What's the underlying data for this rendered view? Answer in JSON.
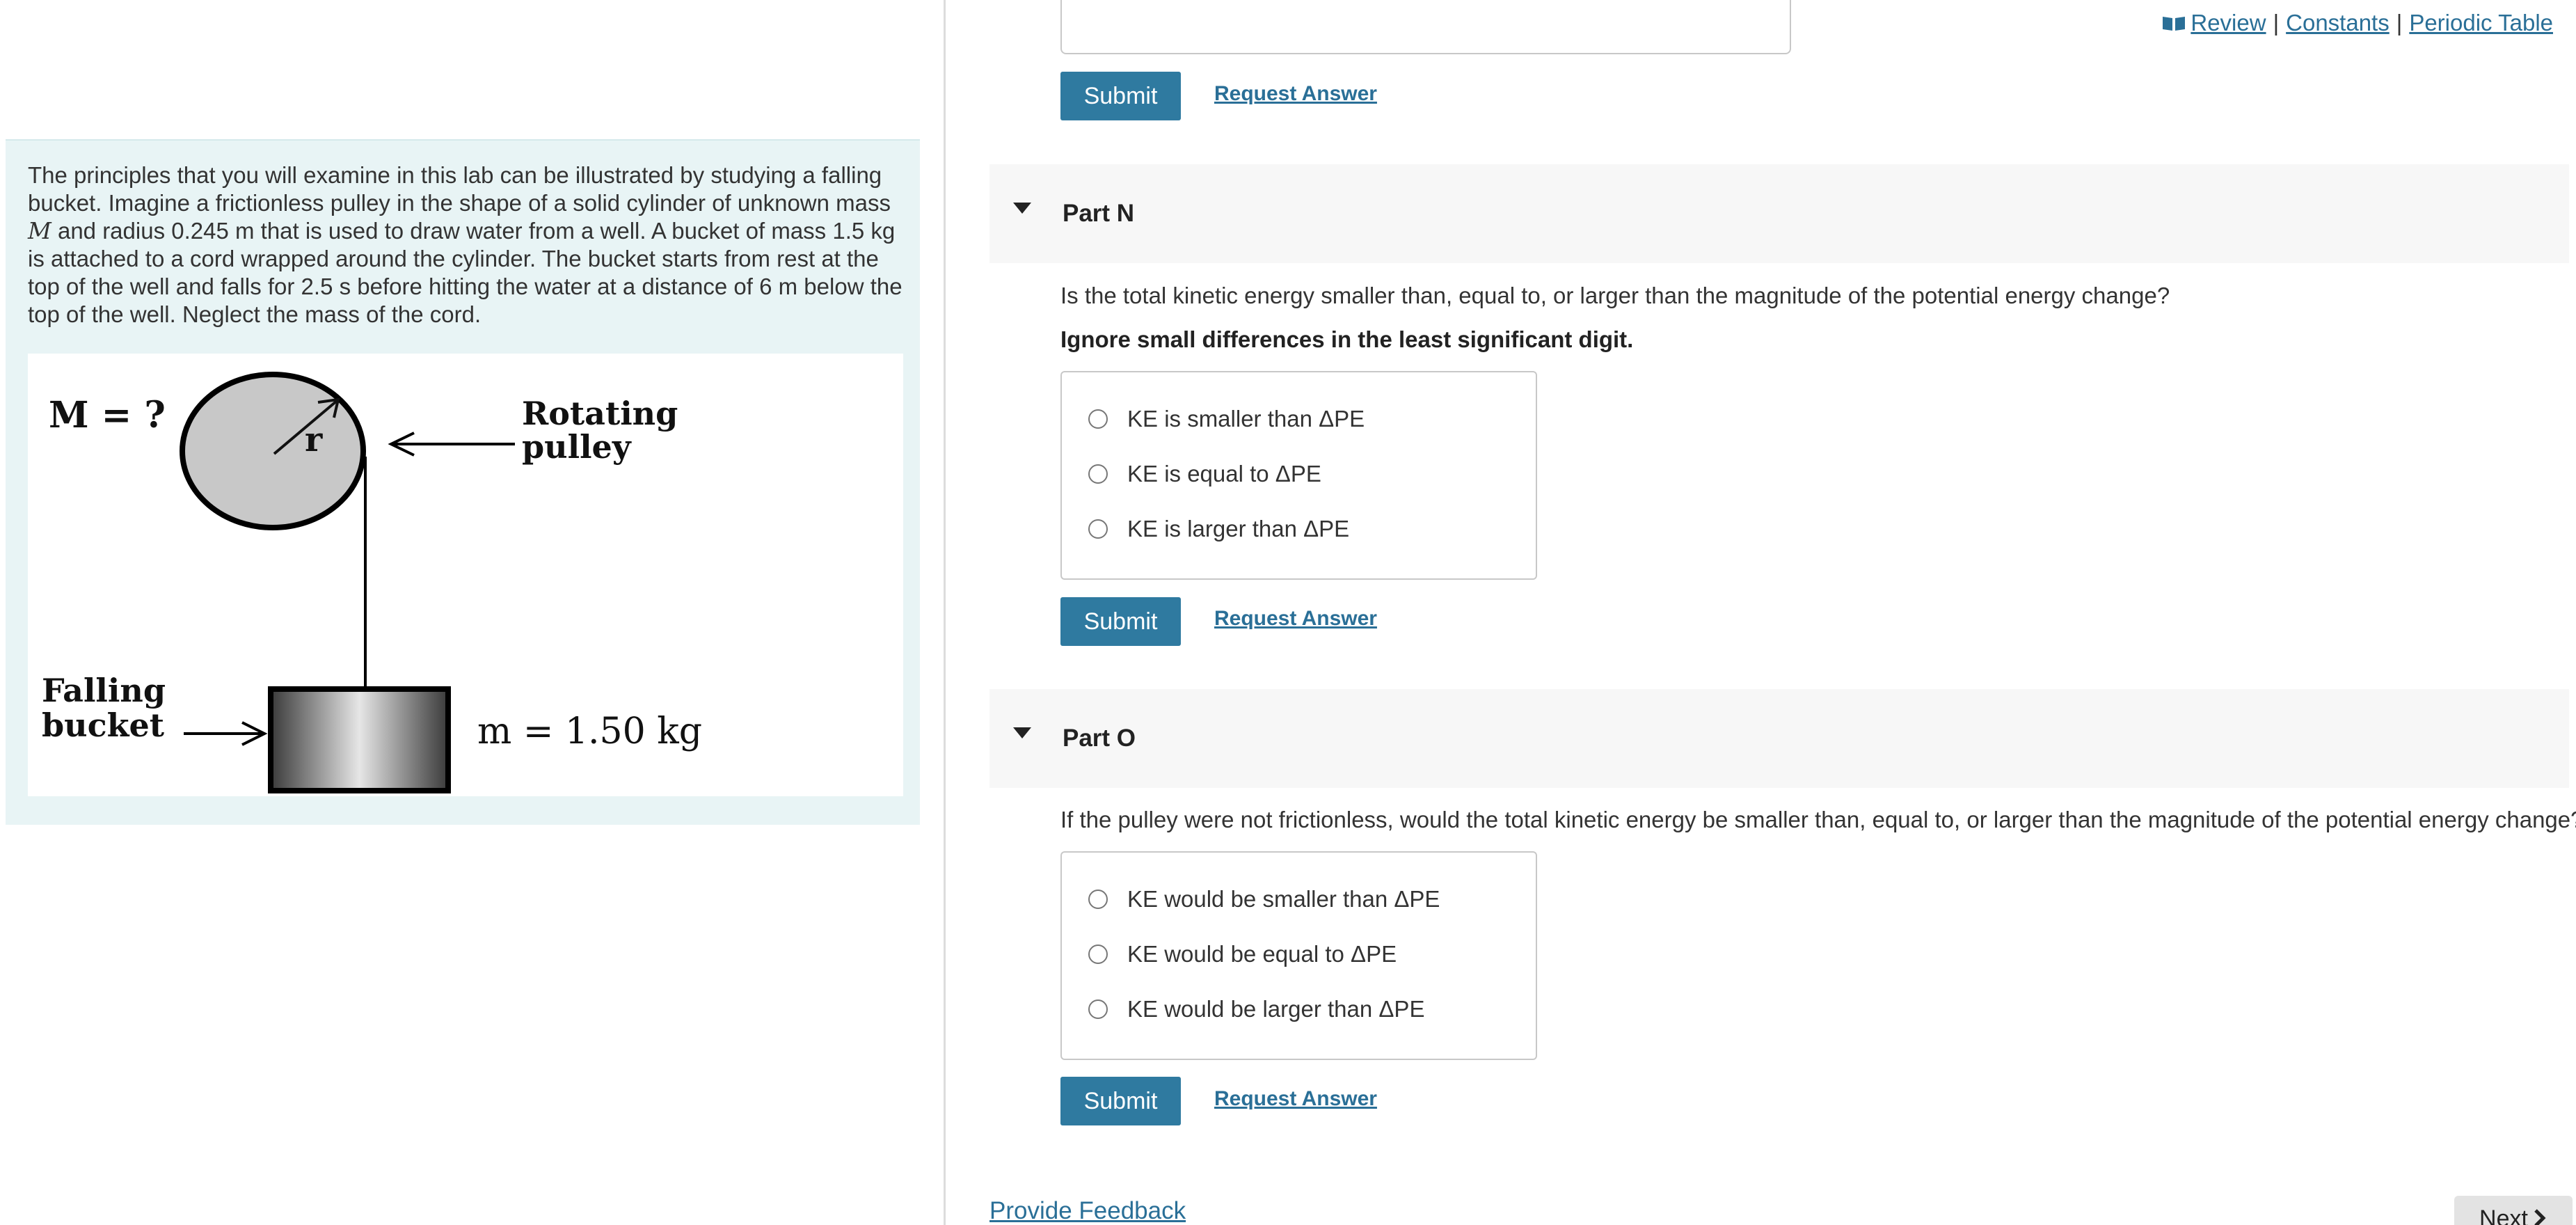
{
  "links": {
    "review": "Review",
    "constants": "Constants",
    "periodic_table": "Periodic Table",
    "sep": "|"
  },
  "intro": {
    "text_1": "The principles that you will examine in this lab can be illustrated by studying a falling bucket. Imagine a frictionless pulley in the shape of a solid cylinder of unknown mass",
    "mass_symbol": "M",
    "text_2": "and radius 0.245 m that is used to draw water from a well. A bucket of mass 1.5 kg is attached to a cord wrapped around the cylinder. The bucket starts from rest at the top of the well and falls for 2.5 s before hitting the water at a distance of 6 m below the top of the well. Neglect the mass of the cord."
  },
  "figure": {
    "mass_label": "M = ?",
    "radius_label": "r",
    "pulley_label_1": "Rotating",
    "pulley_label_2": "pulley",
    "bucket_label_1": "Falling",
    "bucket_label_2": "bucket",
    "bucket_mass": "m = 1.50 kg"
  },
  "top_section": {
    "submit": "Submit",
    "request": "Request Answer"
  },
  "part_n": {
    "title": "Part N",
    "question": "Is the total kinetic energy smaller than, equal to, or larger than the magnitude of the potential energy change?",
    "note": "Ignore small differences in the least significant digit.",
    "choices": [
      "KE is smaller than ΔPE",
      "KE is equal to ΔPE",
      "KE is larger than ΔPE"
    ],
    "submit": "Submit",
    "request": "Request Answer"
  },
  "part_o": {
    "title": "Part O",
    "question": "If the pulley were not frictionless, would the total kinetic energy be smaller than, equal to, or larger than the magnitude of the potential energy change?",
    "choices": [
      "KE would be smaller than ΔPE",
      "KE would be equal to ΔPE",
      "KE would be larger than ΔPE"
    ],
    "submit": "Submit",
    "request": "Request Answer"
  },
  "footer": {
    "feedback": "Provide Feedback",
    "next": "Next",
    "next_icon": "chevron-right-icon"
  },
  "colors": {
    "accent": "#2f7aa0",
    "link": "#2a6f97",
    "intro_bg": "#e8f4f5"
  }
}
